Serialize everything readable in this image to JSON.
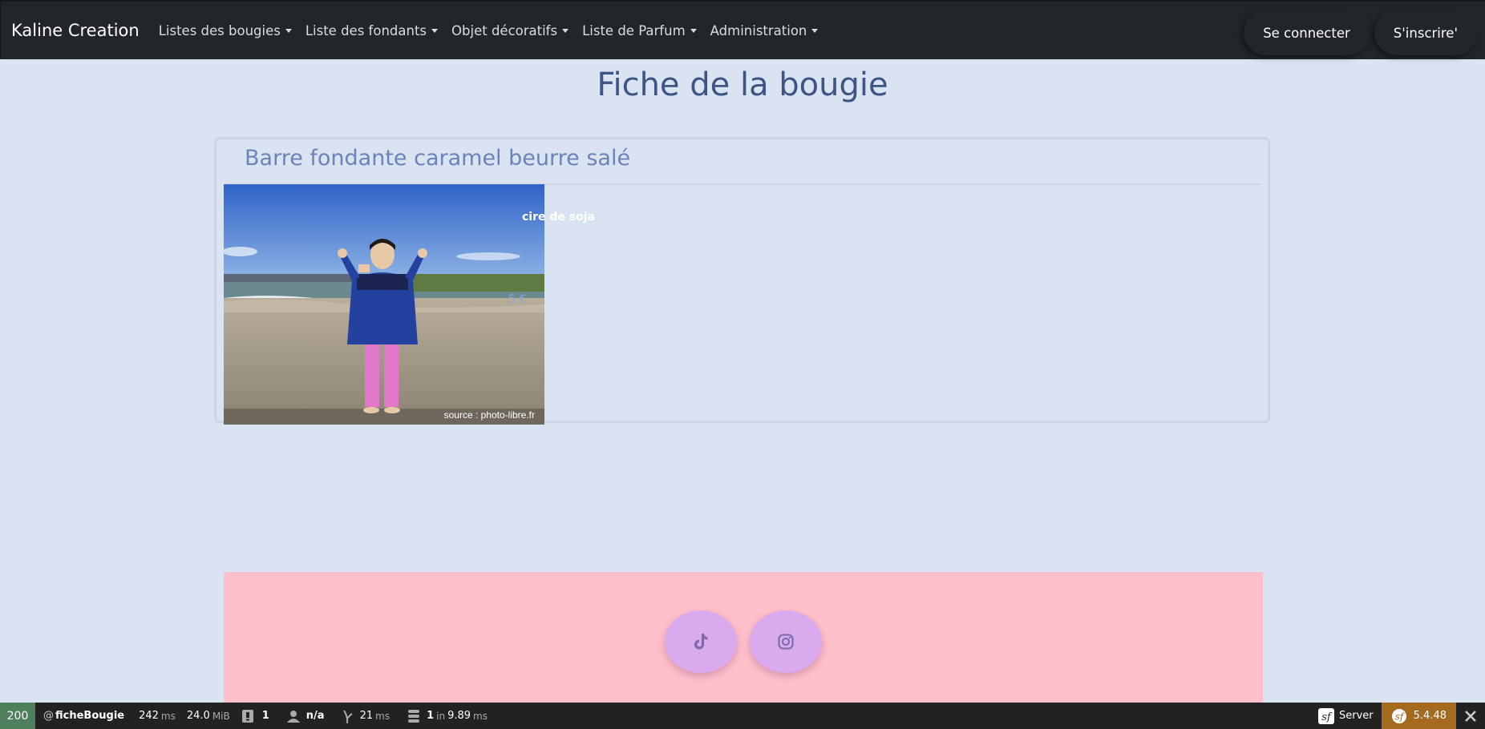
{
  "navbar": {
    "brand": "Kaline Creation",
    "items": [
      {
        "label": "Listes des bougies"
      },
      {
        "label": "Liste des fondants"
      },
      {
        "label": "Objet décoratifs"
      },
      {
        "label": "Liste de Parfum"
      },
      {
        "label": "Administration"
      }
    ],
    "login_label": "Se connecter",
    "signup_label": "S'inscrire'"
  },
  "page": {
    "title": "Fiche de la bougie",
    "product": {
      "name": "Barre fondante caramel beurre salé",
      "material": "cire de soja",
      "price": "5 €",
      "image_caption": "source : photo-libre.fr"
    }
  },
  "footer": {
    "social": [
      {
        "icon": "tiktok-icon"
      },
      {
        "icon": "instagram-icon"
      }
    ]
  },
  "debug_toolbar": {
    "status": "200",
    "route_prefix": "@",
    "route": "ficheBougie",
    "time_value": "242",
    "time_unit": "ms",
    "memory_value": "24.0",
    "memory_unit": "MiB",
    "logs": "1",
    "user": "n/a",
    "twig_value": "21",
    "twig_unit": "ms",
    "db_queries": "1",
    "db_in": "in",
    "db_time": "9.89",
    "db_unit": "ms",
    "server_label": "Server",
    "version": "5.4.48"
  },
  "colors": {
    "navbar_bg": "#22262b",
    "page_bg": "#d9e3f2",
    "title": "#3e5485",
    "footer_bg": "#ffc0cb",
    "social_btn": "#d9aaee",
    "status_ok": "#4f805d",
    "symfony_version": "#a46a1f"
  }
}
